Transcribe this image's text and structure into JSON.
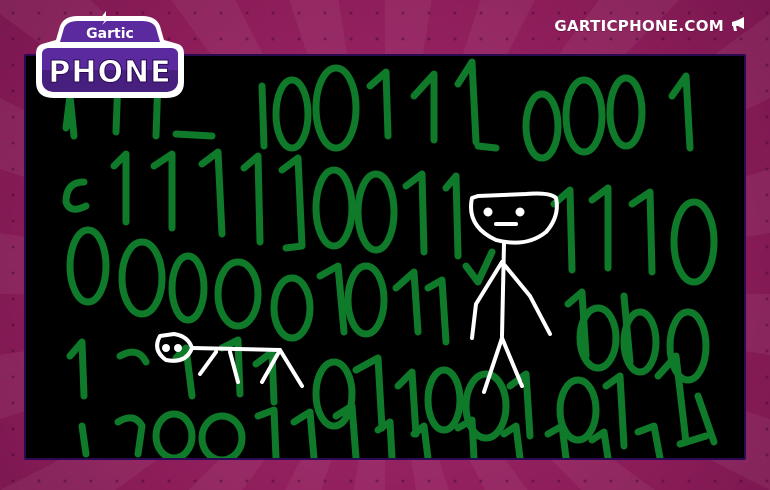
{
  "header": {
    "logo_top": "Gartic",
    "logo_bottom": "PHONE",
    "site_label": "GARTICPHONE.COM"
  },
  "colors": {
    "background": "#8e1f5e",
    "canvas": "#000000",
    "ink_green": "#0f7a2a",
    "ink_white": "#ffffff",
    "logo_purple": "#5a2a9e"
  },
  "icons": {
    "site_link_icon": "megaphone-icon"
  },
  "drawing": {
    "description_visible": false
  }
}
